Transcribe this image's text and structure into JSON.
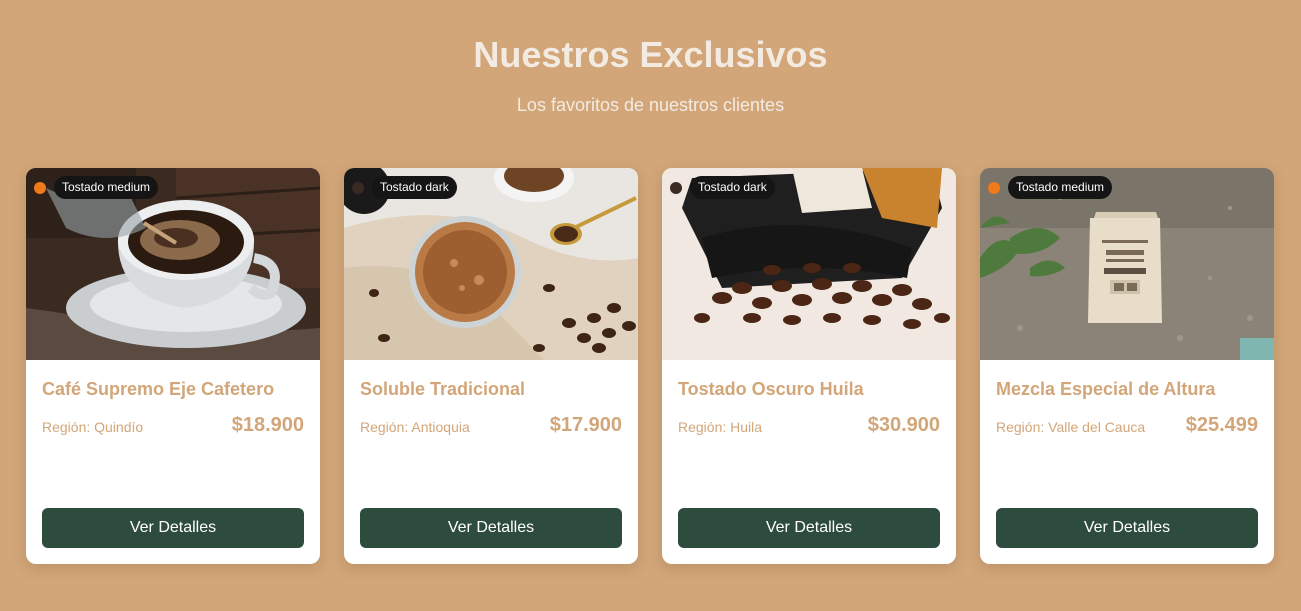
{
  "header": {
    "title": "Nuestros Exclusivos",
    "subtitle": "Los favoritos de nuestros clientes"
  },
  "colors": {
    "background": "#d2a679",
    "accent_text": "#d2a679",
    "button": "#2d4c3d",
    "badge_bg": "#151515"
  },
  "products": [
    {
      "roast": "Tostado medium",
      "roast_dot_color": "#f07a1a",
      "name": "Café Supremo Eje Cafetero",
      "region": "Región: Quindío",
      "price": "$18.900",
      "button_label": "Ver Detalles",
      "image": "coffee-cup-pour-photo"
    },
    {
      "roast": "Tostado dark",
      "roast_dot_color": "#3a2a24",
      "name": "Soluble Tradicional",
      "region": "Región: Antioquia",
      "price": "$17.900",
      "button_label": "Ver Detalles",
      "image": "instant-coffee-jar-photo"
    },
    {
      "roast": "Tostado dark",
      "roast_dot_color": "#3a2a24",
      "name": "Tostado Oscuro Huila",
      "region": "Región: Huila",
      "price": "$30.900",
      "button_label": "Ver Detalles",
      "image": "coffee-beans-bag-photo"
    },
    {
      "roast": "Tostado medium",
      "roast_dot_color": "#f07a1a",
      "name": "Mezcla Especial de Altura",
      "region": "Región: Valle del Cauca",
      "price": "$25.499",
      "button_label": "Ver Detalles",
      "image": "coffee-bag-ground-photo"
    }
  ]
}
